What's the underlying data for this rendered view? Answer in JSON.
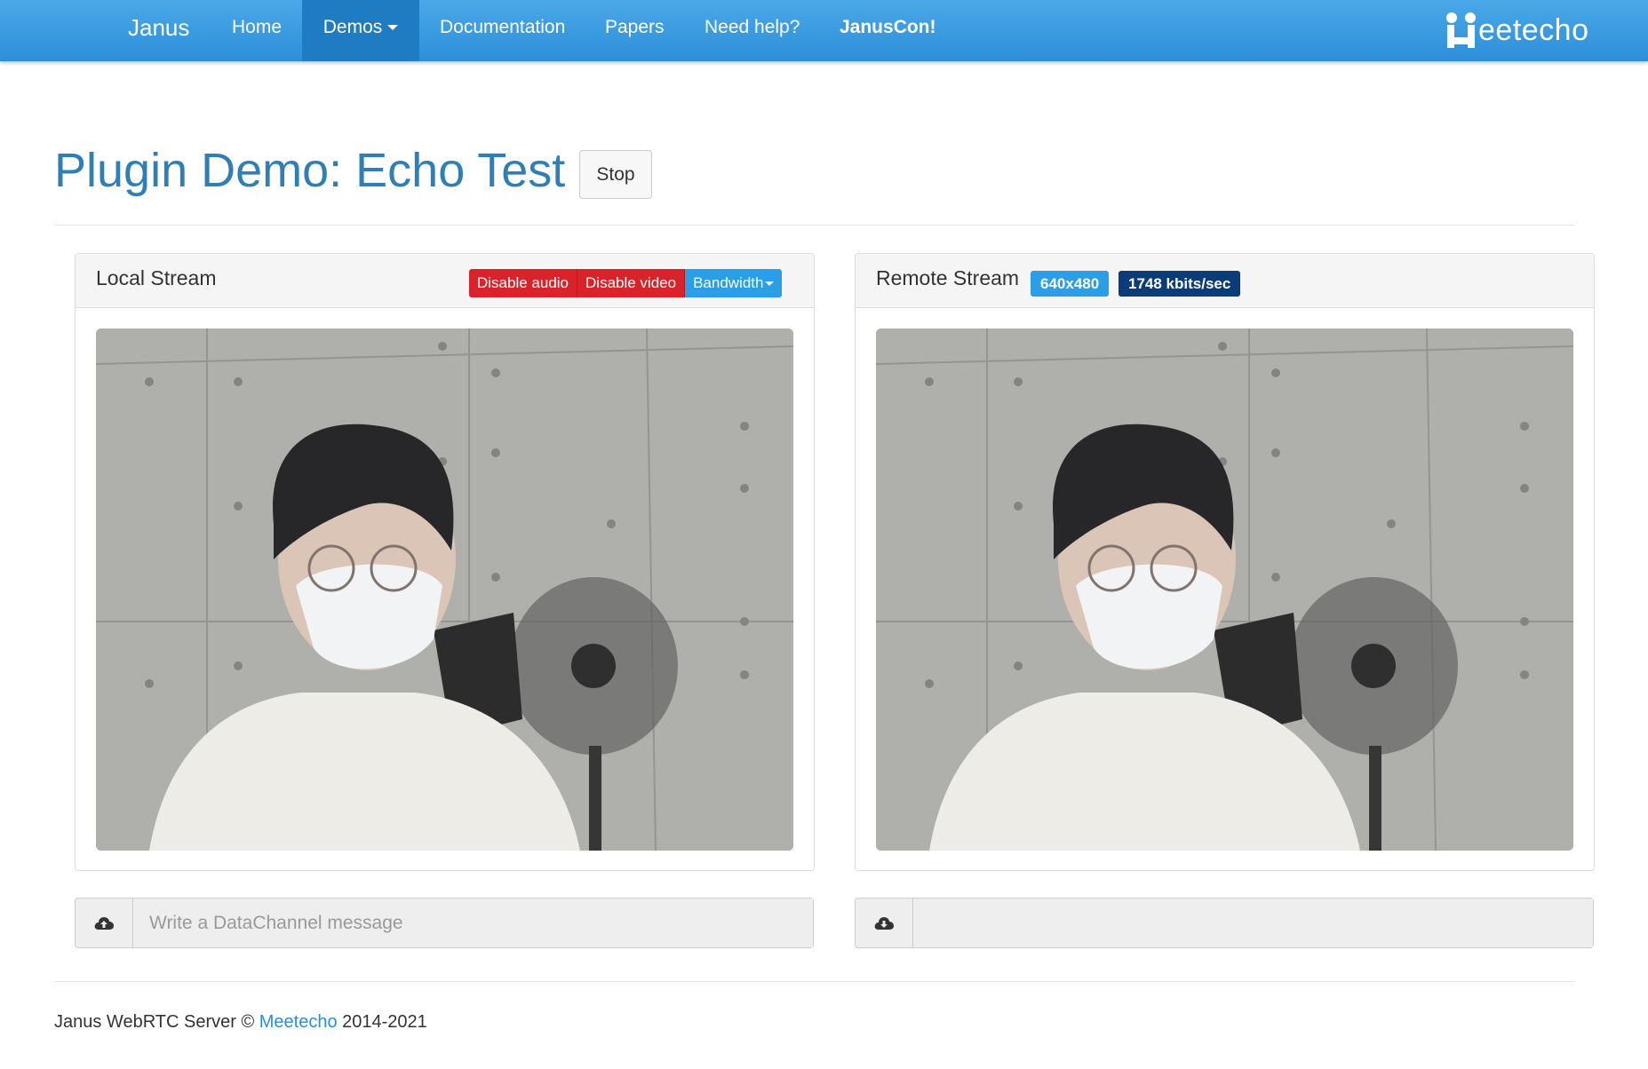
{
  "navbar": {
    "brand": "Janus",
    "items": [
      {
        "label": "Home"
      },
      {
        "label": "Demos"
      },
      {
        "label": "Documentation"
      },
      {
        "label": "Papers"
      },
      {
        "label": "Need help?"
      },
      {
        "label": "JanusCon!"
      }
    ],
    "logo": "eetecho"
  },
  "header": {
    "title": "Plugin Demo: Echo Test",
    "stop_label": "Stop"
  },
  "local": {
    "title": "Local Stream",
    "disable_audio": "Disable audio",
    "disable_video": "Disable video",
    "bandwidth": "Bandwidth"
  },
  "remote": {
    "title": "Remote Stream",
    "resolution": "640x480",
    "bitrate": "1748 kbits/sec"
  },
  "datachannel": {
    "send_placeholder": "Write a DataChannel message",
    "received": ""
  },
  "footer": {
    "prefix": "Janus WebRTC Server ©",
    "link": "Meetecho",
    "suffix": "2014-2021"
  },
  "colors": {
    "navbar": "#2d8fd8",
    "title": "#2f7fb7",
    "danger": "#d9232a",
    "info": "#2a9ee6",
    "primary": "#0b3c7a"
  },
  "icons": {
    "upload": "cloud-upload-icon",
    "download": "cloud-download-icon"
  }
}
